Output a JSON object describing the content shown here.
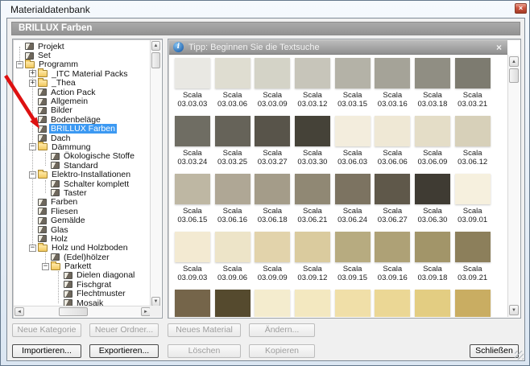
{
  "window": {
    "title": "Materialdatenbank"
  },
  "header": {
    "title": "BRILLUX Farben"
  },
  "icons": {
    "close": "×",
    "info": "i",
    "up": "▲",
    "down": "▼",
    "left": "◄",
    "right": "►",
    "plus": "+",
    "minus": "−"
  },
  "tip_bar": {
    "text": "Tipp: Beginnen Sie die Textsuche"
  },
  "tree": {
    "items": [
      {
        "label": "Projekt",
        "level": 0,
        "icon": "book",
        "expander": null,
        "selected": false
      },
      {
        "label": "Set",
        "level": 0,
        "icon": "book",
        "expander": null,
        "selected": false
      },
      {
        "label": "Programm",
        "level": 0,
        "icon": "folder",
        "expander": "minus",
        "selected": false
      },
      {
        "label": "_ITC Material Packs",
        "level": 1,
        "icon": "folder",
        "expander": "plus",
        "selected": false
      },
      {
        "label": "_Thea",
        "level": 1,
        "icon": "folder",
        "expander": "plus",
        "selected": false
      },
      {
        "label": "Action Pack",
        "level": 1,
        "icon": "book",
        "expander": null,
        "selected": false
      },
      {
        "label": "Allgemein",
        "level": 1,
        "icon": "book",
        "expander": null,
        "selected": false
      },
      {
        "label": "Bilder",
        "level": 1,
        "icon": "book",
        "expander": null,
        "selected": false
      },
      {
        "label": "Bodenbeläge",
        "level": 1,
        "icon": "book",
        "expander": null,
        "selected": false
      },
      {
        "label": "BRILLUX Farben",
        "level": 1,
        "icon": "book",
        "expander": null,
        "selected": true
      },
      {
        "label": "Dach",
        "level": 1,
        "icon": "book",
        "expander": null,
        "selected": false
      },
      {
        "label": "Dämmung",
        "level": 1,
        "icon": "folder",
        "expander": "minus",
        "selected": false
      },
      {
        "label": "Ökologische Stoffe",
        "level": 2,
        "icon": "book",
        "expander": null,
        "selected": false
      },
      {
        "label": "Standard",
        "level": 2,
        "icon": "book",
        "expander": null,
        "selected": false
      },
      {
        "label": "Elektro-Installationen",
        "level": 1,
        "icon": "folder",
        "expander": "minus",
        "selected": false
      },
      {
        "label": "Schalter komplett",
        "level": 2,
        "icon": "book",
        "expander": null,
        "selected": false
      },
      {
        "label": "Taster",
        "level": 2,
        "icon": "book",
        "expander": null,
        "selected": false
      },
      {
        "label": "Farben",
        "level": 1,
        "icon": "book",
        "expander": null,
        "selected": false
      },
      {
        "label": "Fliesen",
        "level": 1,
        "icon": "book",
        "expander": null,
        "selected": false
      },
      {
        "label": "Gemälde",
        "level": 1,
        "icon": "book",
        "expander": null,
        "selected": false
      },
      {
        "label": "Glas",
        "level": 1,
        "icon": "book",
        "expander": null,
        "selected": false
      },
      {
        "label": "Holz",
        "level": 1,
        "icon": "book",
        "expander": null,
        "selected": false
      },
      {
        "label": "Holz und Holzboden",
        "level": 1,
        "icon": "folder",
        "expander": "minus",
        "selected": false
      },
      {
        "label": "(Edel)hölzer",
        "level": 2,
        "icon": "book",
        "expander": null,
        "selected": false
      },
      {
        "label": "Parkett",
        "level": 2,
        "icon": "folder",
        "expander": "minus",
        "selected": false
      },
      {
        "label": "Dielen diagonal",
        "level": 3,
        "icon": "book",
        "expander": null,
        "selected": false
      },
      {
        "label": "Fischgrat",
        "level": 3,
        "icon": "book",
        "expander": null,
        "selected": false
      },
      {
        "label": "Flechtmuster",
        "level": 3,
        "icon": "book",
        "expander": null,
        "selected": false
      },
      {
        "label": "Mosaik",
        "level": 3,
        "icon": "book",
        "expander": null,
        "selected": false
      }
    ]
  },
  "swatches": {
    "name_line": "Scala",
    "rows": [
      [
        {
          "code": "03.03.03",
          "color": "#e9e8e3"
        },
        {
          "code": "03.03.06",
          "color": "#dfddd1"
        },
        {
          "code": "03.03.09",
          "color": "#d4d3c7"
        },
        {
          "code": "03.03.12",
          "color": "#c7c5ba"
        },
        {
          "code": "03.03.15",
          "color": "#b4b2a7"
        },
        {
          "code": "03.03.16",
          "color": "#a5a398"
        },
        {
          "code": "03.03.18",
          "color": "#908e83"
        },
        {
          "code": "03.03.21",
          "color": "#7d7b70"
        }
      ],
      [
        {
          "code": "03.03.24",
          "color": "#6f6d63"
        },
        {
          "code": "03.03.25",
          "color": "#666359"
        },
        {
          "code": "03.03.27",
          "color": "#58544a"
        },
        {
          "code": "03.03.30",
          "color": "#454238"
        },
        {
          "code": "03.06.03",
          "color": "#f3eddd"
        },
        {
          "code": "03.06.06",
          "color": "#efe8d5"
        },
        {
          "code": "03.06.09",
          "color": "#e4ddc7"
        },
        {
          "code": "03.06.12",
          "color": "#d7d0b9"
        }
      ],
      [
        {
          "code": "03.06.15",
          "color": "#beb7a3"
        },
        {
          "code": "03.06.16",
          "color": "#afa795"
        },
        {
          "code": "03.06.18",
          "color": "#a49c89"
        },
        {
          "code": "03.06.21",
          "color": "#908874"
        },
        {
          "code": "03.06.24",
          "color": "#7c7361"
        },
        {
          "code": "03.06.27",
          "color": "#5f584a"
        },
        {
          "code": "03.06.30",
          "color": "#3f3b33"
        },
        {
          "code": "03.09.01",
          "color": "#f6f0de"
        }
      ],
      [
        {
          "code": "03.09.03",
          "color": "#f3ead2"
        },
        {
          "code": "03.09.06",
          "color": "#ede4c8"
        },
        {
          "code": "03.09.09",
          "color": "#e2d3ab"
        },
        {
          "code": "03.09.12",
          "color": "#dacb9e"
        },
        {
          "code": "03.09.15",
          "color": "#b7ab80"
        },
        {
          "code": "03.09.16",
          "color": "#aea176"
        },
        {
          "code": "03.09.18",
          "color": "#a29569"
        },
        {
          "code": "03.09.21",
          "color": "#8c7f5b"
        }
      ],
      [
        {
          "code": "",
          "color": "#75654a"
        },
        {
          "code": "",
          "color": "#554a2e"
        },
        {
          "code": "",
          "color": "#f4ecce"
        },
        {
          "code": "",
          "color": "#f3e8c0"
        },
        {
          "code": "",
          "color": "#f0dfa8"
        },
        {
          "code": "",
          "color": "#ebd795"
        },
        {
          "code": "",
          "color": "#e3cd82"
        },
        {
          "code": "",
          "color": "#c9ad62"
        }
      ]
    ]
  },
  "buttons": {
    "row1": [
      {
        "label": "Neue Kategorie",
        "enabled": false
      },
      {
        "label": "Neuer Ordner...",
        "enabled": false
      },
      {
        "label": "Neues Material",
        "enabled": false
      },
      {
        "label": "Ändern...",
        "enabled": false
      }
    ],
    "row2": [
      {
        "label": "Importieren...",
        "enabled": true
      },
      {
        "label": "Exportieren...",
        "enabled": true
      },
      {
        "label": "Löschen",
        "enabled": false
      },
      {
        "label": "Kopieren",
        "enabled": false
      }
    ],
    "close": {
      "label": "Schließen",
      "enabled": true
    }
  },
  "colors": {
    "selection": "#3c99f2",
    "header_bar": "#9b9b9b",
    "annotation_arrow": "#dd1111",
    "close_button": "#c0442e"
  }
}
